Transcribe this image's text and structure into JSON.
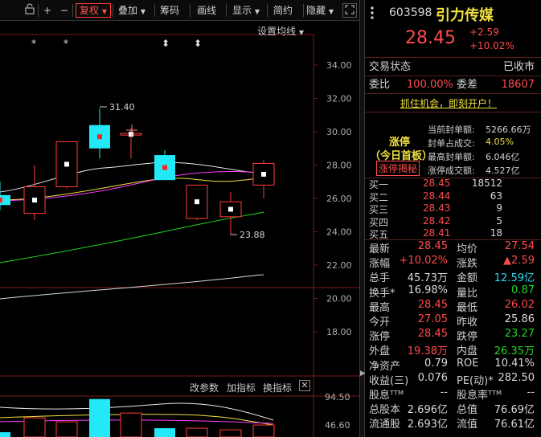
{
  "toolbar": {
    "items": [
      "+",
      "−",
      "复权",
      "叠加",
      "筹码",
      "画线",
      "显示",
      "简约",
      "隐藏"
    ],
    "active": "复权"
  },
  "chart": {
    "ma_setting_label": "设置均线",
    "y_ticks": [
      "34.00",
      "32.00",
      "30.00",
      "28.00",
      "26.00",
      "24.00",
      "22.00",
      "20.00",
      "18.00"
    ],
    "y_tick_values": [
      34,
      32,
      30,
      28,
      26,
      24,
      22,
      20,
      18
    ],
    "high_label": "31.40",
    "low_label": "23.88",
    "sub_links": [
      "改参数",
      "加指标",
      "换指标"
    ],
    "sub_y_ticks": [
      "94.50",
      "46.60"
    ],
    "markers": [
      "*",
      "*",
      "⬍",
      "⬍"
    ]
  },
  "chart_data": {
    "type": "candlestick",
    "ylim": [
      17.5,
      35.2
    ],
    "candles": [
      {
        "open": 26.2,
        "close": 25.6,
        "high": 27.0,
        "low": 25.3,
        "color": "cyan"
      },
      {
        "open": 25.1,
        "close": 26.7,
        "high": 28.0,
        "low": 24.7,
        "color": "red"
      },
      {
        "open": 26.7,
        "close": 29.4,
        "high": 29.4,
        "low": 26.6,
        "color": "red"
      },
      {
        "open": 30.4,
        "close": 29.0,
        "high": 31.4,
        "low": 28.4,
        "color": "cyan"
      },
      {
        "open": 29.9,
        "close": 29.8,
        "high": 30.2,
        "low": 28.4,
        "color": "red"
      },
      {
        "open": 28.6,
        "close": 27.1,
        "high": 28.9,
        "low": 27.1,
        "color": "cyan"
      },
      {
        "open": 26.8,
        "close": 24.8,
        "high": 26.8,
        "low": 24.7,
        "color": "red"
      },
      {
        "open": 24.9,
        "close": 25.8,
        "high": 26.4,
        "low": 23.88,
        "color": "red"
      },
      {
        "open": 26.8,
        "close": 28.1,
        "high": 28.3,
        "low": 26.0,
        "color": "red"
      }
    ],
    "volume_values": [
      12,
      48,
      38,
      95,
      60,
      22,
      22,
      18,
      30
    ]
  },
  "quote": {
    "code": "603598",
    "name": "引力传媒",
    "price": "28.45",
    "change": "+2.59",
    "change_pct": "+10.02%",
    "status_label": "交易状态",
    "status_value": "已收市",
    "weibi_label": "委比",
    "weibi_value": "100.00%",
    "weicha_label": "委差",
    "weicha_value": "18607",
    "promo": "抓住机会，即刻开户！",
    "limit_title": "涨停",
    "limit_sub": "（今日首板）",
    "limit_btn": "涨停揭秘",
    "limit_stats": [
      {
        "label": "当前封单额:",
        "value": "5266.66万"
      },
      {
        "label": "封单占成交:",
        "value": "4.05%"
      },
      {
        "label": "最高封单额:",
        "value": "6.046亿"
      },
      {
        "label": "涨停成交额:",
        "value": "4.527亿"
      }
    ],
    "orders": [
      {
        "label": "买一",
        "price": "28.45",
        "vol": "18512"
      },
      {
        "label": "买二",
        "price": "28.44",
        "vol": "63"
      },
      {
        "label": "买三",
        "price": "28.43",
        "vol": "9"
      },
      {
        "label": "买四",
        "price": "28.42",
        "vol": "5"
      },
      {
        "label": "买五",
        "price": "28.41",
        "vol": "18"
      }
    ],
    "stats": [
      {
        "l1": "最新",
        "v1": "28.45",
        "c1": "red",
        "l2": "均价",
        "v2": "27.54",
        "c2": "red"
      },
      {
        "l1": "涨幅",
        "v1": "+10.02%",
        "c1": "red",
        "l2": "涨跌",
        "v2": "▲2.59",
        "c2": "red"
      },
      {
        "l1": "总手",
        "v1": "45.73万",
        "c1": "white",
        "l2": "金额",
        "v2": "12.59亿",
        "c2": "cyan"
      },
      {
        "l1": "换手*",
        "v1": "16.98%",
        "c1": "white",
        "l2": "量比",
        "v2": "0.87",
        "c2": "green"
      },
      {
        "l1": "最高",
        "v1": "28.45",
        "c1": "red",
        "l2": "最低",
        "v2": "26.02",
        "c2": "red"
      },
      {
        "l1": "今开",
        "v1": "27.05",
        "c1": "red",
        "l2": "昨收",
        "v2": "25.86",
        "c2": "white"
      },
      {
        "l1": "涨停",
        "v1": "28.45",
        "c1": "red",
        "l2": "跌停",
        "v2": "23.27",
        "c2": "green"
      },
      {
        "l1": "外盘",
        "v1": "19.38万",
        "c1": "red",
        "l2": "内盘",
        "v2": "26.35万",
        "c2": "green"
      },
      {
        "l1": "净资产",
        "v1": "0.79",
        "c1": "white",
        "l2": "ROE",
        "v2": "10.41%",
        "c2": "white"
      },
      {
        "l1": "收益(三)",
        "v1": "0.076",
        "c1": "white",
        "l2": "PE(动)*",
        "v2": "282.50",
        "c2": "white"
      },
      {
        "l1": "股息ᵀᵀᴹ",
        "v1": "--",
        "c1": "white",
        "l2": "股息率ᵀᵀᴹ",
        "v2": "--",
        "c2": "white"
      },
      {
        "l1": "总股本",
        "v1": "2.696亿",
        "c1": "white",
        "l2": "总值",
        "v2": "76.69亿",
        "c2": "white"
      },
      {
        "l1": "流通股",
        "v1": "2.693亿",
        "c1": "white",
        "l2": "流值",
        "v2": "76.61亿",
        "c2": "white"
      }
    ]
  }
}
